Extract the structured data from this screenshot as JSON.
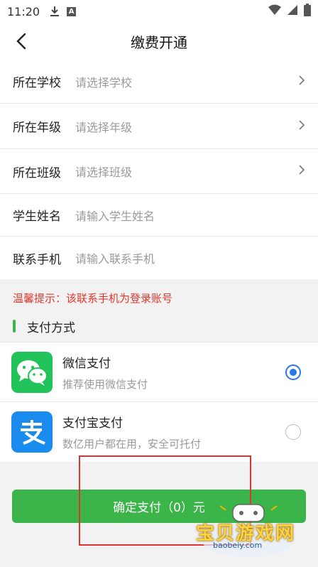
{
  "status_bar": {
    "time": "11:20",
    "a_badge": "A"
  },
  "header": {
    "title": "缴费开通"
  },
  "form": {
    "rows": [
      {
        "label": "所在学校",
        "value": "请选择学校"
      },
      {
        "label": "所在年级",
        "value": "请选择年级"
      },
      {
        "label": "所在班级",
        "value": "请选择班级"
      },
      {
        "label": "学生姓名",
        "value": "请输入学生姓名"
      },
      {
        "label": "联系手机",
        "value": "请输入联系手机"
      }
    ]
  },
  "hint": "温馨提示：该联系手机为登录账号",
  "payment": {
    "section_title": "支付方式",
    "methods": [
      {
        "name": "微信支付",
        "desc": "推荐使用微信支付",
        "selected": true
      },
      {
        "name": "支付宝支付",
        "desc": "数亿用户都在用，安全可托付",
        "selected": false
      }
    ]
  },
  "confirm_label": "确定支付（0）元",
  "watermark": {
    "text": "宝贝游戏网",
    "url": "baobeiy.com"
  },
  "colors": {
    "accent_green": "#3bb44a",
    "radio_blue": "#2a78e4",
    "hint_red": "#e0382f"
  }
}
